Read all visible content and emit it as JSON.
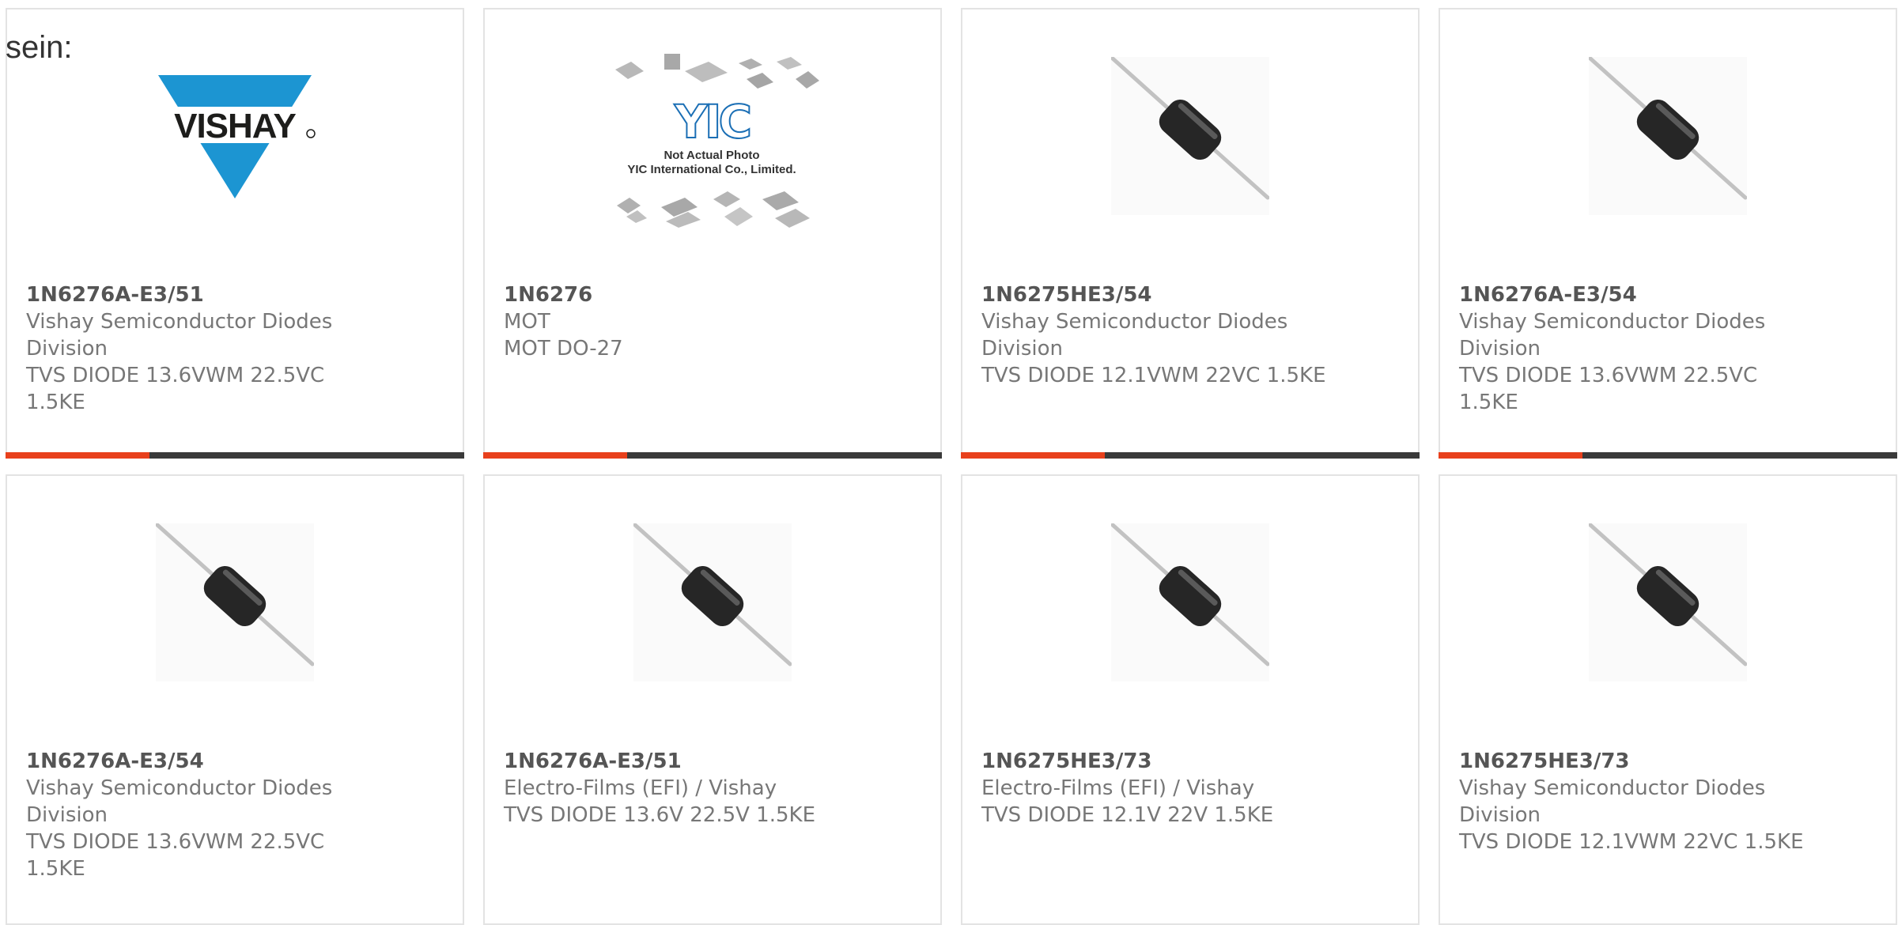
{
  "lead_text": "sein:",
  "colors": {
    "accent": "#e8401c",
    "bar": "#3a3a3a",
    "vishay_blue": "#1c95d2"
  },
  "products": [
    {
      "part": "1N6276A-E3/51",
      "manufacturer": "Vishay Semiconductor Diodes Division",
      "description": "TVS DIODE 13.6VWM 22.5VC 1.5KE",
      "image": "vishay-logo"
    },
    {
      "part": "1N6276",
      "manufacturer": "MOT",
      "description": "MOT DO-27",
      "image": "not-actual-photo-placeholder",
      "image_text": {
        "logo": "YIC",
        "line1": "Not Actual Photo",
        "line2": "YIC International Co., Limited."
      }
    },
    {
      "part": "1N6275HE3/54",
      "manufacturer": "Vishay Semiconductor Diodes Division",
      "description": "TVS DIODE 12.1VWM 22VC 1.5KE",
      "image": "axial-diode-photo"
    },
    {
      "part": "1N6276A-E3/54",
      "manufacturer": "Vishay Semiconductor Diodes Division",
      "description": "TVS DIODE 13.6VWM 22.5VC 1.5KE",
      "image": "axial-diode-photo"
    },
    {
      "part": "1N6276A-E3/54",
      "manufacturer": "Vishay Semiconductor Diodes Division",
      "description": "TVS DIODE 13.6VWM 22.5VC 1.5KE",
      "image": "axial-diode-photo"
    },
    {
      "part": "1N6276A-E3/51",
      "manufacturer": "Electro-Films (EFI) / Vishay",
      "description": "TVS DIODE 13.6V 22.5V 1.5KE",
      "image": "axial-diode-photo"
    },
    {
      "part": "1N6275HE3/73",
      "manufacturer": "Electro-Films (EFI) / Vishay",
      "description": "TVS DIODE 12.1V 22V 1.5KE",
      "image": "axial-diode-photo"
    },
    {
      "part": "1N6275HE3/73",
      "manufacturer": "Vishay Semiconductor Diodes Division",
      "description": "TVS DIODE 12.1VWM 22VC 1.5KE",
      "image": "axial-diode-photo"
    }
  ]
}
